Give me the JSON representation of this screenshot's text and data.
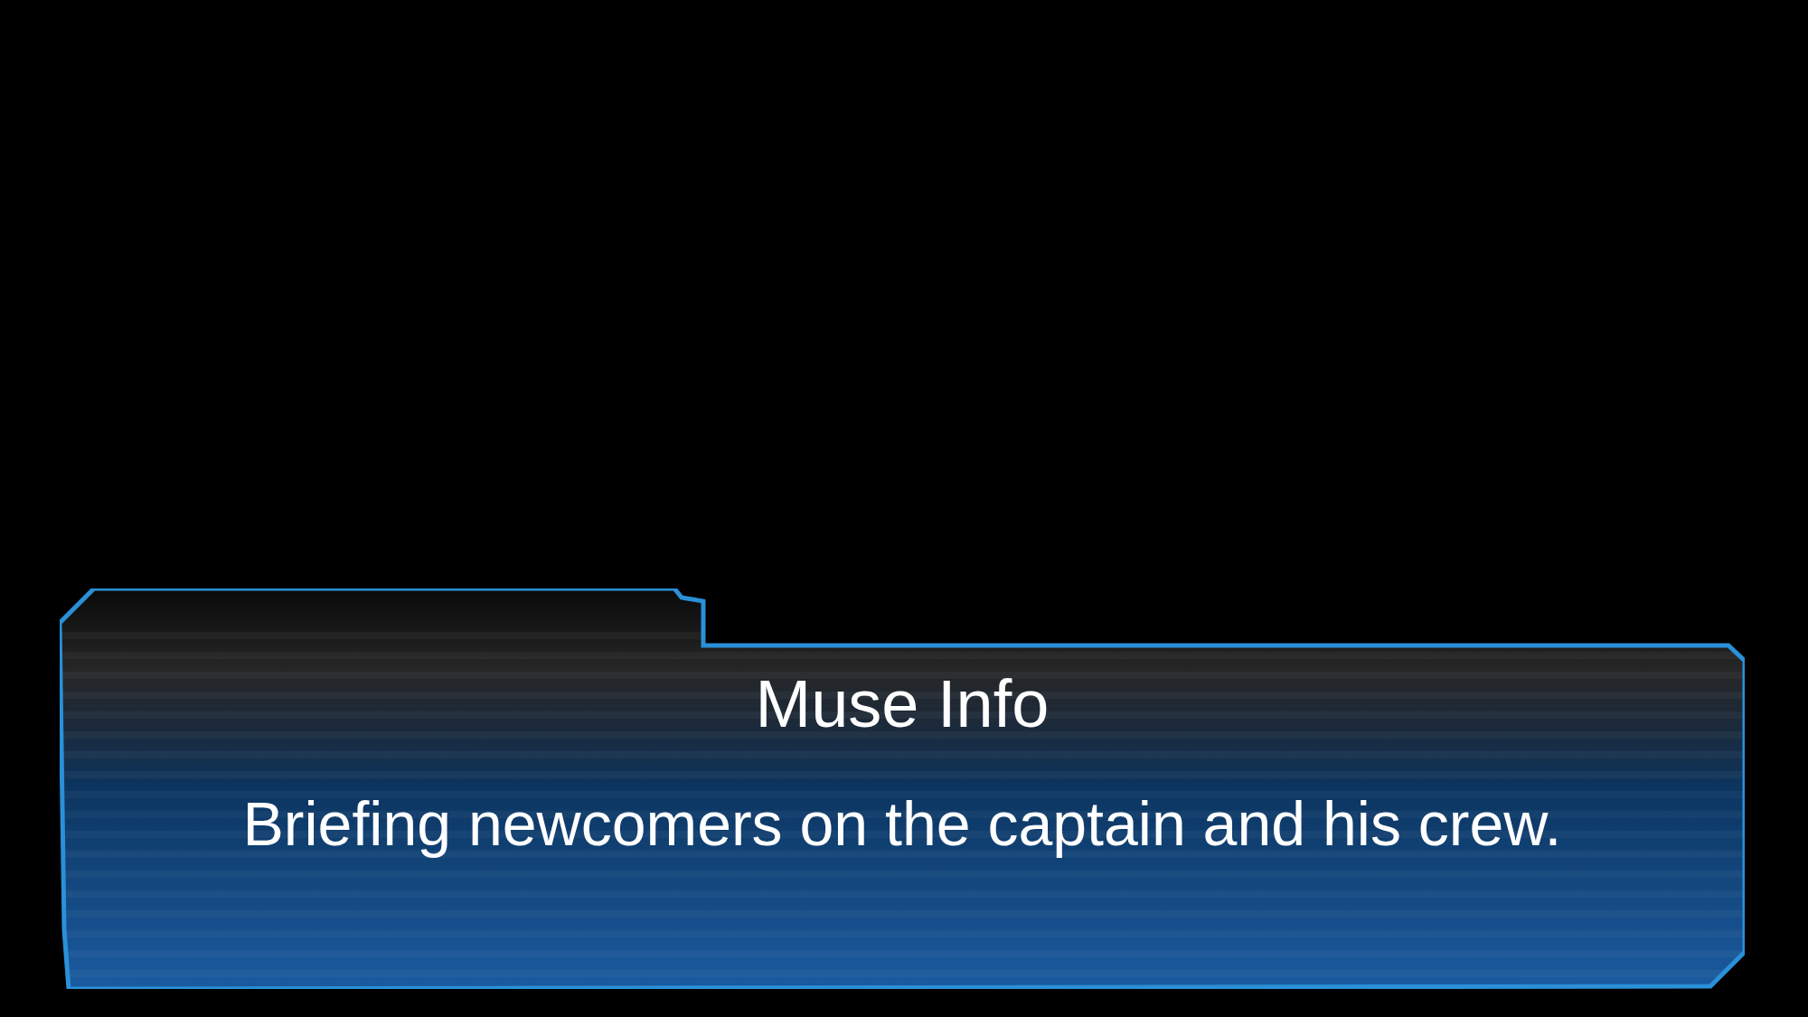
{
  "dialog": {
    "title": "Muse Info",
    "message": "Briefing newcomers on the captain and his crew."
  }
}
